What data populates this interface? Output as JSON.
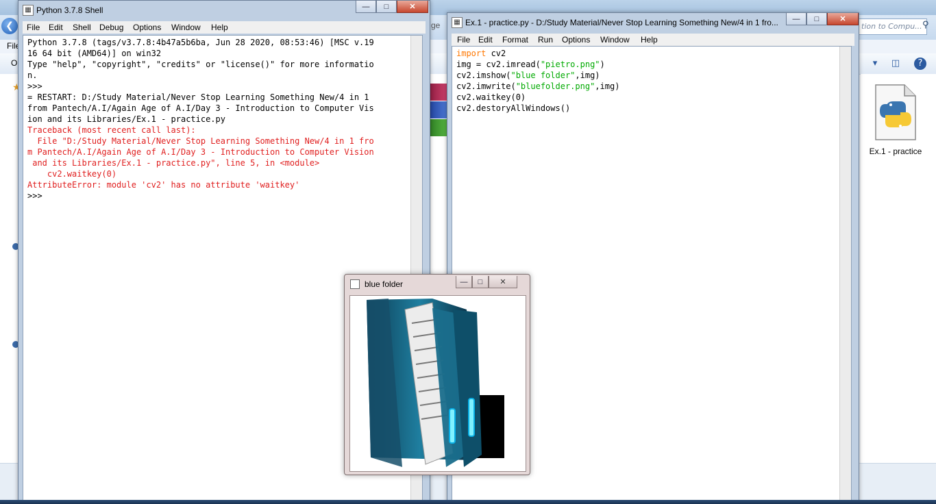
{
  "background": {
    "menu_file": "File",
    "search_placeholder": "tion to Compu...",
    "gap_text": "ge",
    "desktop_file_label": "Ex.1 - practice"
  },
  "shell": {
    "title": "Python 3.7.8 Shell",
    "menu": [
      "File",
      "Edit",
      "Shell",
      "Debug",
      "Options",
      "Window",
      "Help"
    ],
    "lines": [
      {
        "text": "Python 3.7.8 (tags/v3.7.8:4b47a5b6ba, Jun 28 2020, 08:53:46) [MSC v.19",
        "color": "black"
      },
      {
        "text": "16 64 bit (AMD64)] on win32",
        "color": "black"
      },
      {
        "text": "Type \"help\", \"copyright\", \"credits\" or \"license()\" for more informatio",
        "color": "black"
      },
      {
        "text": "n.",
        "color": "black"
      },
      {
        "text": ">>>",
        "color": "black"
      },
      {
        "text": "= RESTART: D:/Study Material/Never Stop Learning Something New/4 in 1",
        "color": "black"
      },
      {
        "text": "from Pantech/A.I/Again Age of A.I/Day 3 - Introduction to Computer Vis",
        "color": "black"
      },
      {
        "text": "ion and its Libraries/Ex.1 - practice.py",
        "color": "black"
      },
      {
        "text": "Traceback (most recent call last):",
        "color": "red"
      },
      {
        "text": "  File \"D:/Study Material/Never Stop Learning Something New/4 in 1 fro",
        "color": "red"
      },
      {
        "text": "m Pantech/A.I/Again Age of A.I/Day 3 - Introduction to Computer Vision",
        "color": "red"
      },
      {
        "text": " and its Libraries/Ex.1 - practice.py\", line 5, in <module>",
        "color": "red"
      },
      {
        "text": "    cv2.waitkey(0)",
        "color": "red"
      },
      {
        "text": "AttributeError: module 'cv2' has no attribute 'waitkey'",
        "color": "red"
      },
      {
        "text": ">>>",
        "color": "black"
      }
    ]
  },
  "editor": {
    "title": "Ex.1 - practice.py - D:/Study Material/Never Stop Learning Something New/4 in 1 fro...",
    "menu": [
      "File",
      "Edit",
      "Format",
      "Run",
      "Options",
      "Window",
      "Help"
    ],
    "code": {
      "l1_kw": "import",
      "l1_rest": " cv2",
      "l2_a": "img = cv2.imread(",
      "l2_s": "\"pietro.png\"",
      "l2_b": ")",
      "l3_a": "cv2.imshow(",
      "l3_s": "\"blue folder\"",
      "l3_b": ",img)",
      "l4_a": "cv2.imwrite(",
      "l4_s": "\"bluefolder.png\"",
      "l4_b": ",img)",
      "l5": "cv2.waitkey(0)",
      "l6": "cv2.destoryAllWindows()"
    }
  },
  "image_window": {
    "title": "blue folder"
  },
  "colors": {
    "keyword": "#ff7700",
    "string": "#00aa00",
    "error": "#e01e1e"
  }
}
